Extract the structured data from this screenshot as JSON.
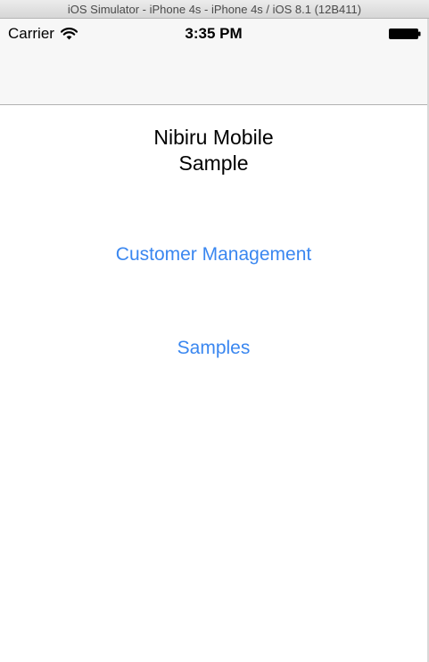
{
  "window": {
    "title": "iOS Simulator - iPhone 4s - iPhone 4s / iOS 8.1 (12B411)"
  },
  "status_bar": {
    "carrier": "Carrier",
    "time": "3:35 PM",
    "wifi_icon": "wifi-icon",
    "battery_icon": "battery-icon"
  },
  "main": {
    "title_line1": "Nibiru Mobile",
    "title_line2": "Sample",
    "buttons": [
      {
        "label": "Customer Management"
      },
      {
        "label": "Samples"
      }
    ]
  },
  "colors": {
    "accent": "#3a87f0",
    "nav_background": "#f7f7f7"
  }
}
